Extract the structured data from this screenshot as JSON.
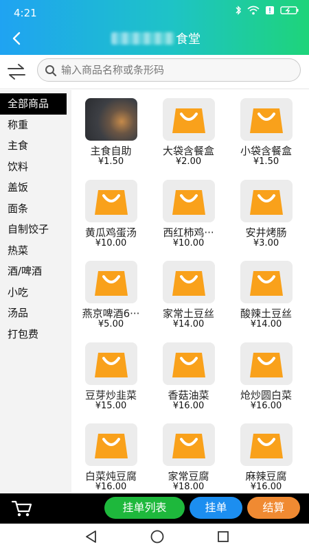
{
  "status_bar": {
    "time": "4:21"
  },
  "header": {
    "title_suffix": "食堂"
  },
  "search": {
    "placeholder": "输入商品名称或条形码"
  },
  "categories": [
    {
      "label": "全部商品",
      "active": true
    },
    {
      "label": "称重"
    },
    {
      "label": "主食"
    },
    {
      "label": "饮料"
    },
    {
      "label": "盖饭"
    },
    {
      "label": "面条"
    },
    {
      "label": "自制饺子"
    },
    {
      "label": "热菜"
    },
    {
      "label": "酒/啤酒"
    },
    {
      "label": "小吃"
    },
    {
      "label": "汤品"
    },
    {
      "label": "打包费"
    }
  ],
  "products": [
    {
      "name": "主食自助",
      "price": "¥1.50",
      "image": "photo"
    },
    {
      "name": "大袋含餐盒",
      "price": "¥2.00",
      "image": "bag-icon"
    },
    {
      "name": "小袋含餐盒",
      "price": "¥1.50",
      "image": "bag-icon"
    },
    {
      "name": "黄瓜鸡蛋汤",
      "price": "¥10.00",
      "image": "bag-icon"
    },
    {
      "name": "西红柿鸡···",
      "price": "¥10.00",
      "image": "bag-icon"
    },
    {
      "name": "安井烤肠",
      "price": "¥3.00",
      "image": "bag-icon"
    },
    {
      "name": "燕京啤酒6···",
      "price": "¥5.00",
      "image": "bag-icon"
    },
    {
      "name": "家常土豆丝",
      "price": "¥14.00",
      "image": "bag-icon"
    },
    {
      "name": "酸辣土豆丝",
      "price": "¥14.00",
      "image": "bag-icon"
    },
    {
      "name": "豆芽炒韭菜",
      "price": "¥15.00",
      "image": "bag-icon"
    },
    {
      "name": "香菇油菜",
      "price": "¥16.00",
      "image": "bag-icon"
    },
    {
      "name": "炝炒圆白菜",
      "price": "¥16.00",
      "image": "bag-icon"
    },
    {
      "name": "白菜炖豆腐",
      "price": "¥16.00",
      "image": "bag-icon"
    },
    {
      "name": "家常豆腐",
      "price": "¥18.00",
      "image": "bag-icon"
    },
    {
      "name": "麻辣豆腐",
      "price": "¥16.00",
      "image": "bag-icon"
    }
  ],
  "bottom_bar": {
    "list_label": "挂单列表",
    "hold_label": "挂单",
    "checkout_label": "结算"
  },
  "colors": {
    "header_start": "#1fa3f2",
    "header_end": "#1ed47a",
    "bag_orange": "#f9a11b",
    "btn_green": "#1eb83c",
    "btn_blue": "#1c8ef0",
    "btn_orange": "#f08a32"
  }
}
